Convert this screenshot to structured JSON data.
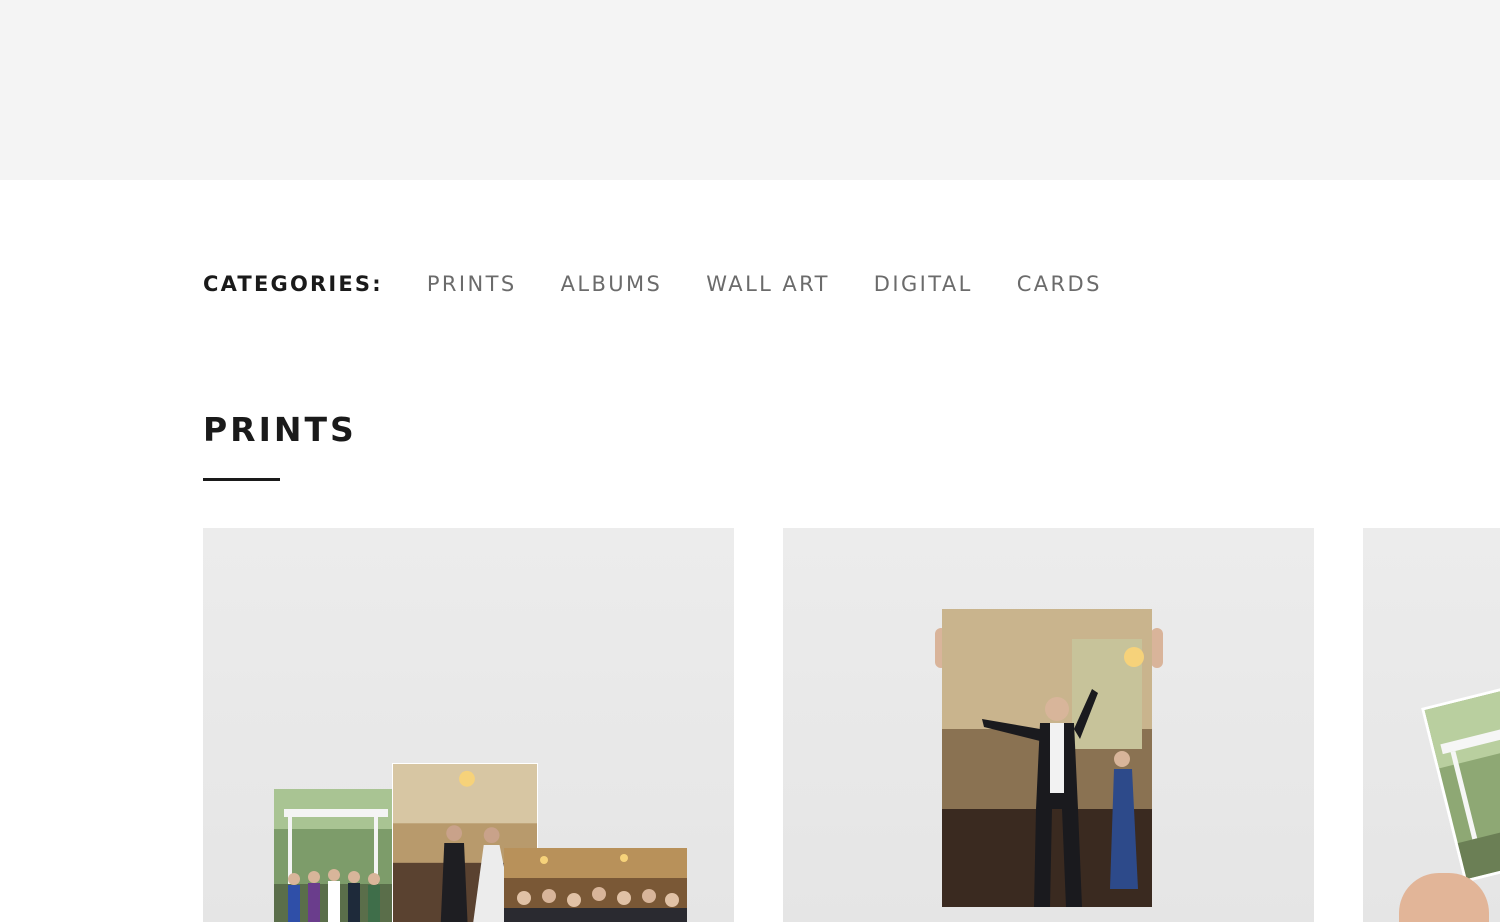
{
  "categories": {
    "label": "CATEGORIES:",
    "items": [
      "PRINTS",
      "ALBUMS",
      "WALL ART",
      "DIGITAL",
      "CARDS"
    ]
  },
  "section": {
    "title": "PRINTS"
  }
}
